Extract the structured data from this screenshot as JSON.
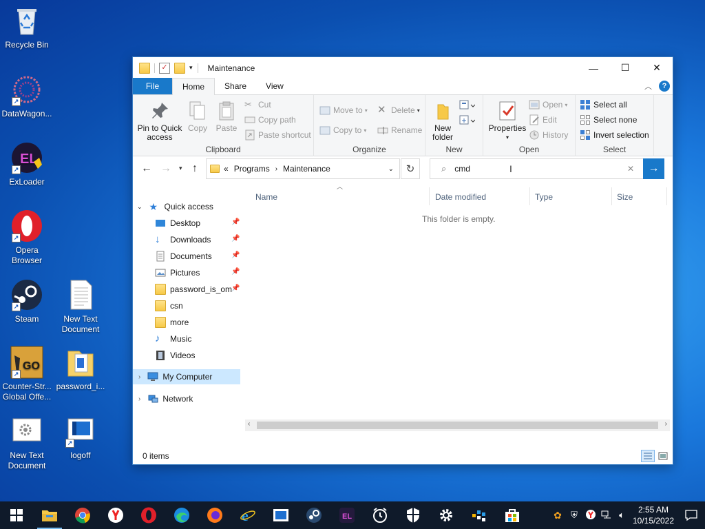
{
  "desktop": {
    "icons": [
      {
        "label": "Recycle Bin"
      },
      {
        "label": "DataWagon..."
      },
      {
        "label": "ExLoader"
      },
      {
        "label": "Opera Browser"
      },
      {
        "label": "Steam"
      },
      {
        "label": "New Text Document"
      },
      {
        "label": "Counter-Str... Global Offe..."
      },
      {
        "label": "password_i..."
      },
      {
        "label": "New Text Document"
      },
      {
        "label": "logoff"
      }
    ]
  },
  "window": {
    "title": "Maintenance",
    "controls": {
      "minimize": "—",
      "maximize": "☐",
      "close": "✕"
    },
    "tabs": {
      "file": "File",
      "home": "Home",
      "share": "Share",
      "view": "View"
    },
    "help": "?",
    "ribbon": {
      "clipboard": {
        "label": "Clipboard",
        "pin": "Pin to Quick access",
        "copy": "Copy",
        "paste": "Paste",
        "cut": "Cut",
        "copy_path": "Copy path",
        "paste_shortcut": "Paste shortcut"
      },
      "organize": {
        "label": "Organize",
        "move_to": "Move to",
        "copy_to": "Copy to",
        "delete": "Delete",
        "rename": "Rename"
      },
      "new": {
        "label": "New",
        "new_folder": "New folder"
      },
      "open": {
        "label": "Open",
        "properties": "Properties",
        "open": "Open",
        "edit": "Edit",
        "history": "History"
      },
      "select": {
        "label": "Select",
        "select_all": "Select all",
        "select_none": "Select none",
        "invert": "Invert selection"
      }
    },
    "address": {
      "overflow": "«",
      "crumbs": [
        "Programs",
        "Maintenance"
      ]
    },
    "search": {
      "value": "cmd"
    },
    "nav": {
      "quick_access": "Quick access",
      "items": [
        "Desktop",
        "Downloads",
        "Documents",
        "Pictures",
        "password_is_om",
        "csn",
        "more",
        "Music",
        "Videos"
      ],
      "my_computer": "My Computer",
      "network": "Network"
    },
    "columns": {
      "name": "Name",
      "date": "Date modified",
      "type": "Type",
      "size": "Size"
    },
    "empty_message": "This folder is empty.",
    "status": "0 items"
  },
  "taskbar": {
    "time": "2:55 AM",
    "date": "10/15/2022"
  },
  "colors": {
    "accent": "#1979ca",
    "selected": "#cce8ff",
    "taskbar": "#0f1a2a"
  }
}
